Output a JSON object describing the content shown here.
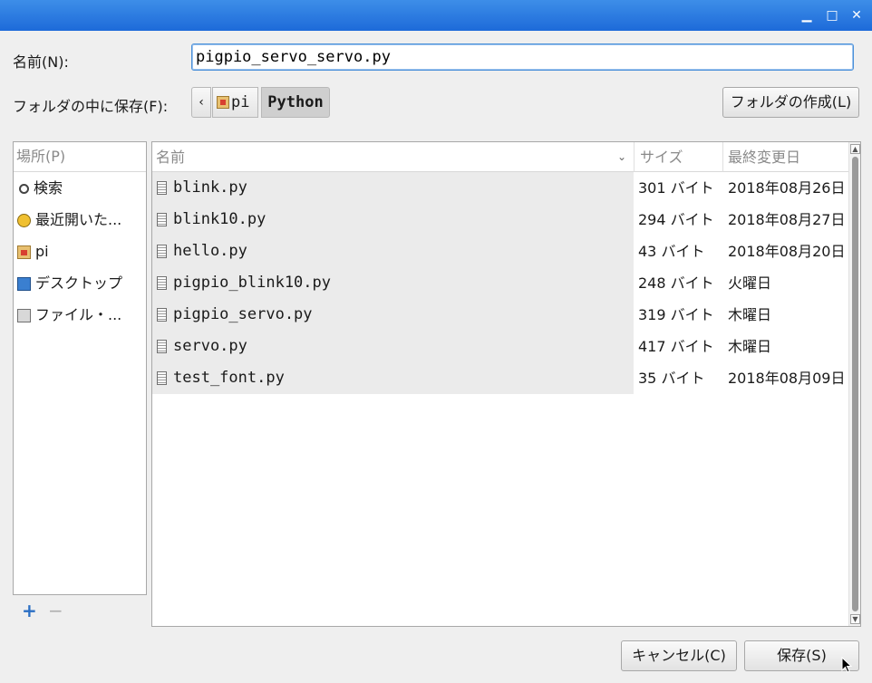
{
  "window": {
    "minimize_glyph": "▁",
    "maximize_glyph": "□",
    "close_glyph": "✕"
  },
  "name_label": "名前(N):",
  "name_value": "pigpio_servo_servo.py",
  "folder_label": "フォルダの中に保存(F):",
  "breadcrumb": {
    "back_glyph": "‹",
    "items": [
      "pi",
      "Python"
    ]
  },
  "create_folder_label": "フォルダの作成(L)",
  "places": {
    "header": "場所(P)",
    "items": [
      {
        "label": "検索",
        "icon": "search-icon"
      },
      {
        "label": "最近開いた...",
        "icon": "recent-icon"
      },
      {
        "label": "pi",
        "icon": "home-folder-icon"
      },
      {
        "label": "デスクトップ",
        "icon": "desktop-icon"
      },
      {
        "label": "ファイル・...",
        "icon": "filesystem-icon"
      }
    ],
    "add_glyph": "+",
    "remove_glyph": "−"
  },
  "files": {
    "columns": {
      "name": "名前",
      "size": "サイズ",
      "modified": "最終変更日"
    },
    "rows": [
      {
        "name": "blink.py",
        "size": "301 バイト",
        "modified": "2018年08月26日"
      },
      {
        "name": "blink10.py",
        "size": "294 バイト",
        "modified": "2018年08月27日"
      },
      {
        "name": "hello.py",
        "size": "43 バイト",
        "modified": "2018年08月20日"
      },
      {
        "name": "pigpio_blink10.py",
        "size": "248 バイト",
        "modified": "火曜日"
      },
      {
        "name": "pigpio_servo.py",
        "size": "319 バイト",
        "modified": "木曜日"
      },
      {
        "name": "servo.py",
        "size": "417 バイト",
        "modified": "木曜日"
      },
      {
        "name": "test_font.py",
        "size": "35 バイト",
        "modified": "2018年08月09日"
      }
    ]
  },
  "buttons": {
    "cancel": "キャンセル(C)",
    "save": "保存(S)"
  },
  "colors": {
    "titlebar": "#1d6ad9",
    "focus": "#4a90d9",
    "add": "#2b6fc4"
  }
}
